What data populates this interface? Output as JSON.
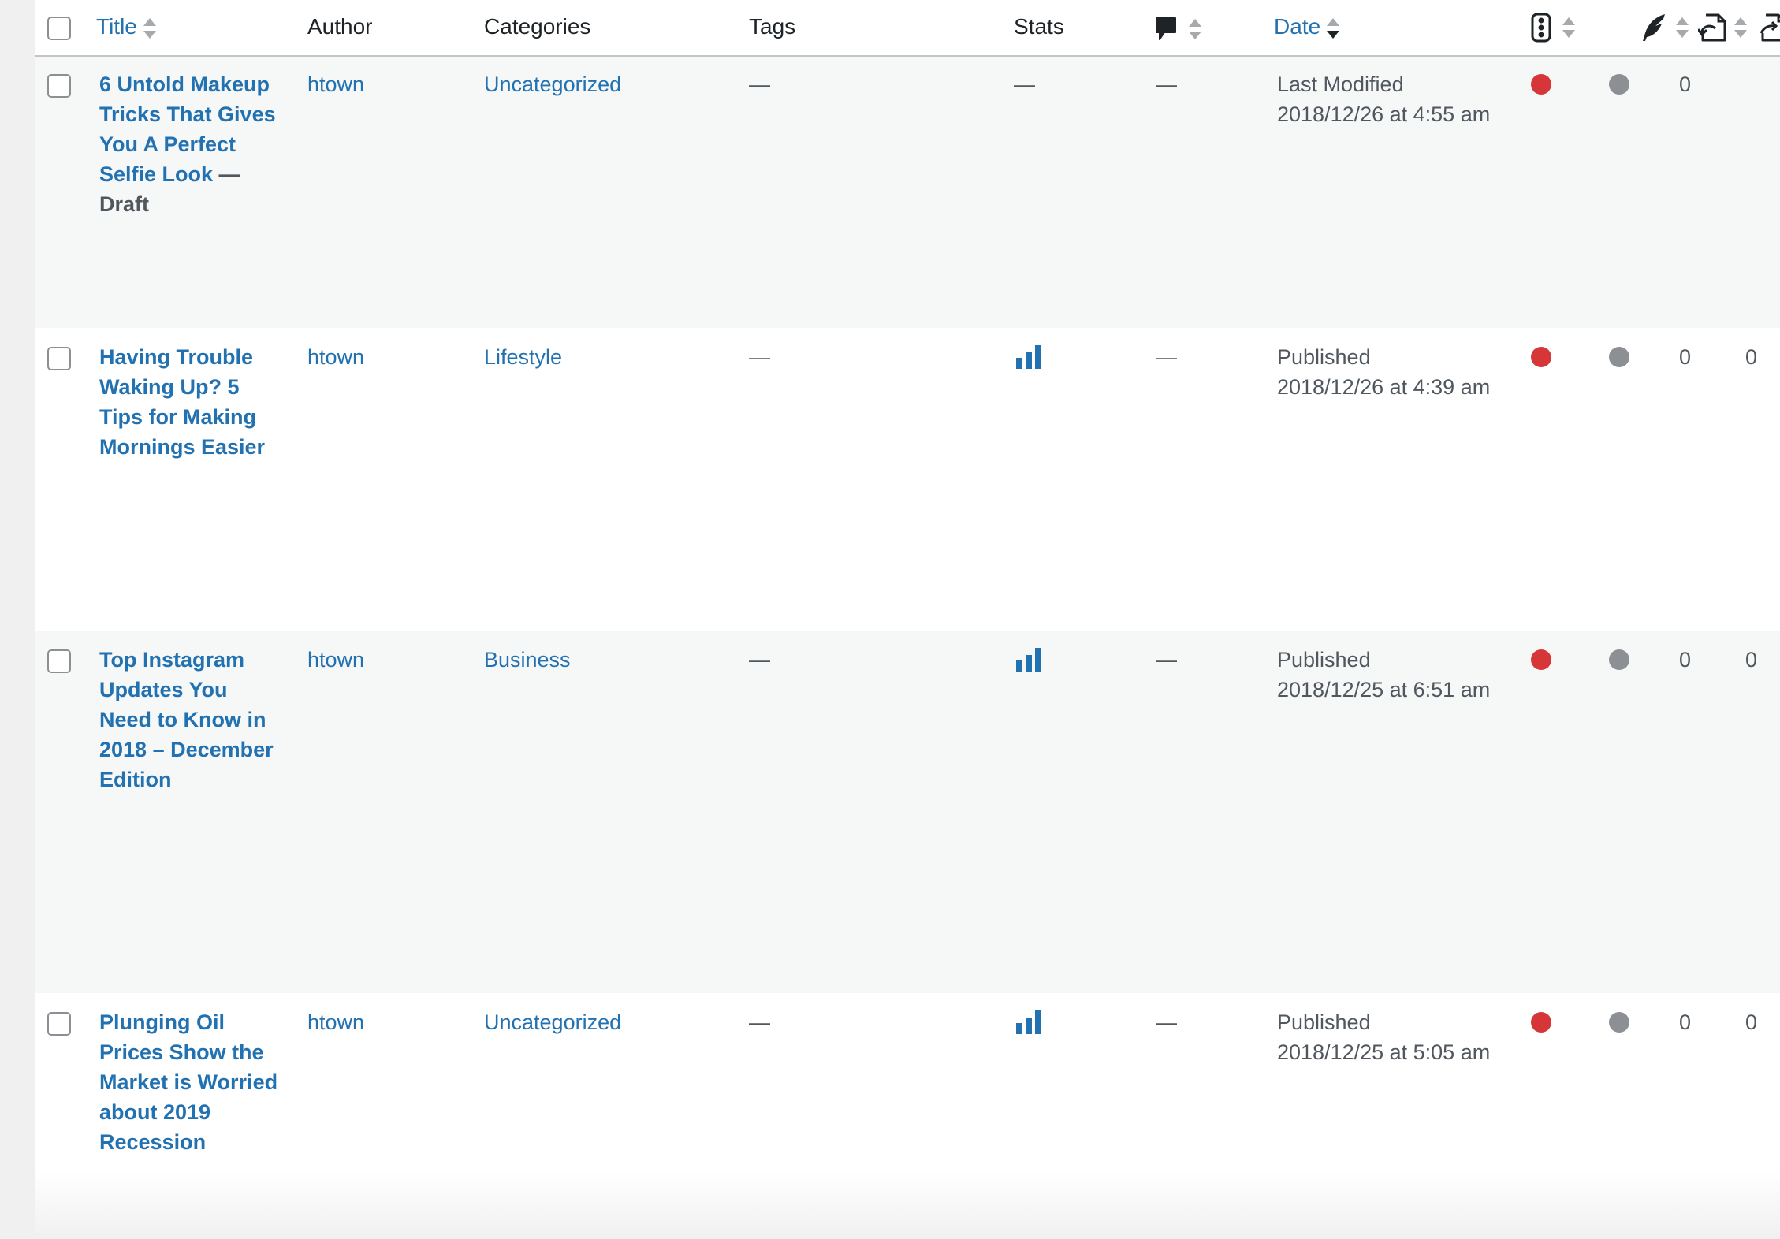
{
  "header": {
    "title_label": "Title",
    "author_label": "Author",
    "categories_label": "Categories",
    "tags_label": "Tags",
    "stats_label": "Stats",
    "date_label": "Date",
    "icons": [
      "comment-icon",
      "traffic-light-icon",
      "feather-icon",
      "inbound-link-icon",
      "outbound-link-icon"
    ]
  },
  "rows": [
    {
      "title": "6 Untold Makeup Tricks That Gives You A Perfect Selfie Look",
      "state": "— Draft",
      "author": "htown",
      "category": "Uncategorized",
      "tags": "—",
      "stats": "—",
      "comments": "—",
      "date_status": "Last Modified",
      "date_value": "2018/12/26 at 4:55 am",
      "seo_status": "red",
      "readability_status": "grey",
      "linked_in": "0",
      "linked_out": ""
    },
    {
      "title": "Having Trouble Waking Up? 5 Tips for Making Mornings Easier",
      "state": "",
      "author": "htown",
      "category": "Lifestyle",
      "tags": "—",
      "stats": "chart-bars-icon",
      "comments": "—",
      "date_status": "Published",
      "date_value": "2018/12/26 at 4:39 am",
      "seo_status": "red",
      "readability_status": "grey",
      "linked_in": "0",
      "linked_out": "0"
    },
    {
      "title": "Top Instagram Updates You Need to Know in 2018 – December Edition",
      "state": "",
      "author": "htown",
      "category": "Business",
      "tags": "—",
      "stats": "chart-bars-icon",
      "comments": "—",
      "date_status": "Published",
      "date_value": "2018/12/25 at 6:51 am",
      "seo_status": "red",
      "readability_status": "grey",
      "linked_in": "0",
      "linked_out": "0"
    },
    {
      "title": "Plunging Oil Prices Show the Market is Worried about 2019 Recession",
      "state": "",
      "author": "htown",
      "category": "Uncategorized",
      "tags": "—",
      "stats": "chart-bars-icon",
      "comments": "—",
      "date_status": "Published",
      "date_value": "2018/12/25 at 5:05 am",
      "seo_status": "red",
      "readability_status": "grey",
      "linked_in": "0",
      "linked_out": "0"
    }
  ],
  "colors": {
    "link": "#2271b1",
    "seo_bad": "#d63638",
    "readability_na": "#8c8f94"
  }
}
